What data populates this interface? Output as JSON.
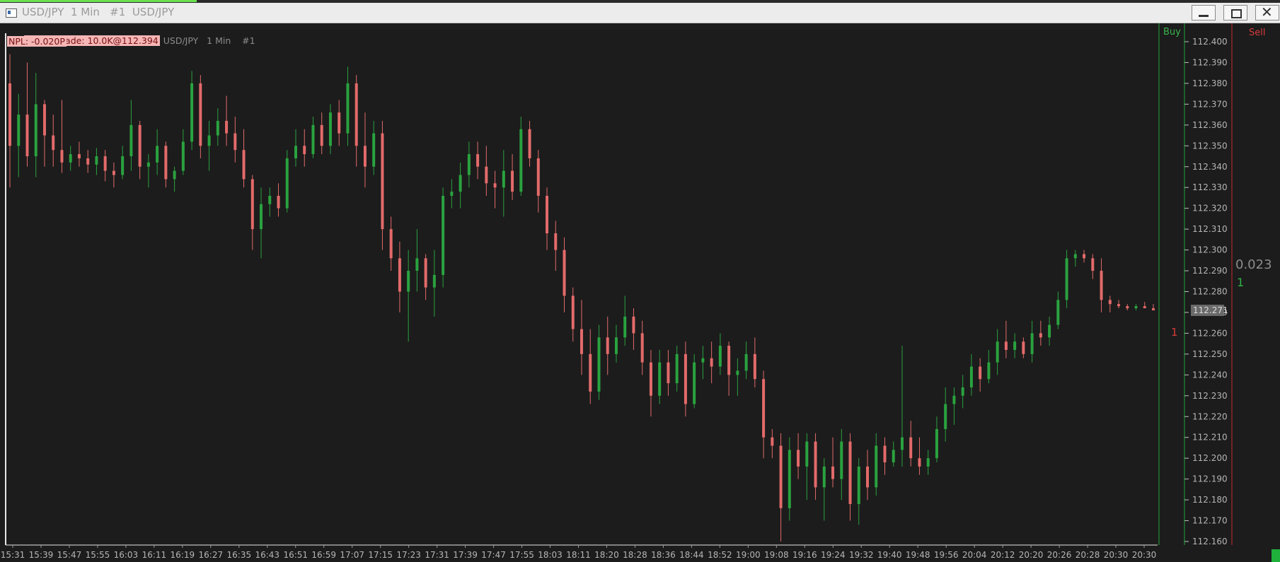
{
  "window": {
    "title": "USD/JPY  1 Min   #1  USD/JPY"
  },
  "chart_header": {
    "sim_tag": "[Sim]   Trade: 10.0K@112.394",
    "caption": "USD/JPY   1 Min    #1",
    "npl": "NPL: -0.020P"
  },
  "order_panel": {
    "buy_label": "Buy",
    "sell_label": "Sell",
    "position_value": "0.023",
    "position_qty": "1",
    "order_qty": "1"
  },
  "colors": {
    "up": "#2aa23f",
    "down": "#e36a6a",
    "buy_line": "#21a33a",
    "sell_line": "#c92a2a",
    "grid_axis": "#d0d0d0",
    "last_price_bg": "#6a6a6a"
  },
  "chart_data": {
    "type": "candlestick",
    "symbol": "USD/JPY",
    "interval": "1 Min",
    "ylim": [
      112.16,
      112.4
    ],
    "y_ticks": [
      "112.160",
      "112.170",
      "112.180",
      "112.190",
      "112.200",
      "112.210",
      "112.220",
      "112.230",
      "112.240",
      "112.250",
      "112.260",
      "112.270",
      "112.280",
      "112.290",
      "112.300",
      "112.310",
      "112.320",
      "112.330",
      "112.340",
      "112.350",
      "112.360",
      "112.370",
      "112.380",
      "112.390",
      "112.400"
    ],
    "x_ticks": [
      "15:31",
      "15:39",
      "15:47",
      "15:55",
      "16:03",
      "16:11",
      "16:19",
      "16:27",
      "16:35",
      "16:43",
      "16:51",
      "16:59",
      "17:07",
      "17:15",
      "17:23",
      "17:31",
      "17:39",
      "17:47",
      "17:55",
      "18:03",
      "18:11",
      "18:20",
      "18:28",
      "18:36",
      "18:44",
      "18:52",
      "19:00",
      "19:08",
      "19:16",
      "19:24",
      "19:32",
      "19:40",
      "19:48",
      "19:56",
      "20:04",
      "20:12",
      "20:20",
      "20:26",
      "20:28",
      "20:30",
      "20:30"
    ],
    "last_price": "112.271",
    "trade_price": 112.394,
    "candles": [
      [
        112.38,
        112.394,
        112.33,
        112.35
      ],
      [
        112.35,
        112.375,
        112.335,
        112.365
      ],
      [
        112.365,
        112.39,
        112.34,
        112.345
      ],
      [
        112.345,
        112.385,
        112.335,
        112.37
      ],
      [
        112.37,
        112.372,
        112.34,
        112.355
      ],
      [
        112.355,
        112.365,
        112.34,
        112.348
      ],
      [
        112.348,
        112.372,
        112.337,
        112.342
      ],
      [
        112.342,
        112.35,
        112.338,
        112.346
      ],
      [
        112.346,
        112.352,
        112.34,
        112.344
      ],
      [
        112.344,
        112.348,
        112.337,
        112.341
      ],
      [
        112.341,
        112.349,
        112.336,
        112.345
      ],
      [
        112.345,
        112.348,
        112.333,
        112.338
      ],
      [
        112.338,
        112.342,
        112.33,
        112.336
      ],
      [
        112.336,
        112.35,
        112.334,
        112.345
      ],
      [
        112.345,
        112.372,
        112.338,
        112.36
      ],
      [
        112.36,
        112.362,
        112.334,
        112.34
      ],
      [
        112.34,
        112.346,
        112.33,
        112.342
      ],
      [
        112.342,
        112.358,
        112.336,
        112.35
      ],
      [
        112.35,
        112.352,
        112.33,
        112.334
      ],
      [
        112.334,
        112.34,
        112.328,
        112.338
      ],
      [
        112.338,
        112.358,
        112.336,
        112.352
      ],
      [
        112.352,
        112.386,
        112.348,
        112.38
      ],
      [
        112.38,
        112.384,
        112.344,
        112.35
      ],
      [
        112.35,
        112.362,
        112.338,
        112.355
      ],
      [
        112.355,
        112.368,
        112.35,
        112.362
      ],
      [
        112.362,
        112.374,
        112.35,
        112.356
      ],
      [
        112.356,
        112.364,
        112.342,
        112.348
      ],
      [
        112.348,
        112.358,
        112.33,
        112.334
      ],
      [
        112.334,
        112.336,
        112.3,
        112.31
      ],
      [
        112.31,
        112.33,
        112.296,
        112.322
      ],
      [
        112.322,
        112.33,
        112.316,
        112.326
      ],
      [
        112.326,
        112.332,
        112.316,
        112.32
      ],
      [
        112.32,
        112.348,
        112.318,
        112.344
      ],
      [
        112.344,
        112.358,
        112.34,
        112.35
      ],
      [
        112.35,
        112.358,
        112.34,
        112.346
      ],
      [
        112.346,
        112.364,
        112.344,
        112.36
      ],
      [
        112.36,
        112.366,
        112.346,
        112.35
      ],
      [
        112.35,
        112.37,
        112.346,
        112.366
      ],
      [
        112.366,
        112.372,
        112.35,
        112.356
      ],
      [
        112.356,
        112.388,
        112.35,
        112.38
      ],
      [
        112.38,
        112.384,
        112.34,
        112.35
      ],
      [
        112.35,
        112.366,
        112.33,
        112.34
      ],
      [
        112.34,
        112.362,
        112.336,
        112.356
      ],
      [
        112.356,
        112.362,
        112.3,
        112.31
      ],
      [
        112.31,
        112.316,
        112.29,
        112.296
      ],
      [
        112.296,
        112.304,
        112.27,
        112.28
      ],
      [
        112.28,
        112.3,
        112.256,
        112.29
      ],
      [
        112.29,
        112.31,
        112.28,
        112.296
      ],
      [
        112.296,
        112.298,
        112.276,
        112.282
      ],
      [
        112.282,
        112.3,
        112.268,
        112.288
      ],
      [
        112.288,
        112.33,
        112.282,
        112.326
      ],
      [
        112.326,
        112.334,
        112.32,
        112.328
      ],
      [
        112.328,
        112.342,
        112.32,
        112.336
      ],
      [
        112.336,
        112.352,
        112.33,
        112.346
      ],
      [
        112.346,
        112.352,
        112.334,
        112.34
      ],
      [
        112.34,
        112.35,
        112.326,
        112.332
      ],
      [
        112.332,
        112.338,
        112.32,
        112.33
      ],
      [
        112.33,
        112.348,
        112.316,
        112.338
      ],
      [
        112.338,
        112.346,
        112.324,
        112.328
      ],
      [
        112.328,
        112.364,
        112.326,
        112.358
      ],
      [
        112.358,
        112.362,
        112.34,
        112.344
      ],
      [
        112.344,
        112.348,
        112.318,
        112.326
      ],
      [
        112.326,
        112.33,
        112.3,
        112.308
      ],
      [
        112.308,
        112.314,
        112.29,
        112.3
      ],
      [
        112.3,
        112.306,
        112.27,
        112.278
      ],
      [
        112.278,
        112.282,
        112.256,
        112.262
      ],
      [
        112.262,
        112.276,
        112.24,
        112.25
      ],
      [
        112.25,
        112.262,
        112.226,
        112.232
      ],
      [
        112.232,
        112.264,
        112.228,
        112.258
      ],
      [
        112.258,
        112.268,
        112.24,
        112.25
      ],
      [
        112.25,
        112.264,
        112.246,
        112.258
      ],
      [
        112.258,
        112.278,
        112.254,
        112.268
      ],
      [
        112.268,
        112.272,
        112.252,
        112.26
      ],
      [
        112.26,
        112.266,
        112.24,
        112.246
      ],
      [
        112.246,
        112.252,
        112.22,
        112.23
      ],
      [
        112.23,
        112.252,
        112.226,
        112.246
      ],
      [
        112.246,
        112.252,
        112.23,
        112.236
      ],
      [
        112.236,
        112.254,
        112.232,
        112.25
      ],
      [
        112.25,
        112.256,
        112.22,
        112.226
      ],
      [
        112.226,
        112.25,
        112.224,
        112.246
      ],
      [
        112.246,
        112.254,
        112.238,
        112.248
      ],
      [
        112.248,
        112.256,
        112.236,
        112.244
      ],
      [
        112.244,
        112.26,
        112.24,
        112.254
      ],
      [
        112.254,
        112.256,
        112.23,
        112.24
      ],
      [
        112.24,
        112.248,
        112.23,
        112.242
      ],
      [
        112.242,
        112.256,
        112.238,
        112.25
      ],
      [
        112.25,
        112.258,
        112.234,
        112.238
      ],
      [
        112.238,
        112.242,
        112.2,
        112.21
      ],
      [
        112.21,
        112.214,
        112.2,
        112.206
      ],
      [
        112.206,
        112.212,
        112.16,
        112.176
      ],
      [
        112.176,
        112.21,
        112.17,
        112.204
      ],
      [
        112.204,
        112.212,
        112.19,
        112.196
      ],
      [
        112.196,
        112.212,
        112.18,
        112.208
      ],
      [
        112.208,
        112.212,
        112.18,
        112.186
      ],
      [
        112.186,
        112.2,
        112.17,
        112.196
      ],
      [
        112.196,
        112.21,
        112.186,
        112.19
      ],
      [
        112.19,
        112.214,
        112.18,
        112.208
      ],
      [
        112.208,
        112.212,
        112.17,
        112.178
      ],
      [
        112.178,
        112.2,
        112.168,
        112.196
      ],
      [
        112.196,
        112.204,
        112.18,
        112.186
      ],
      [
        112.186,
        112.212,
        112.182,
        112.206
      ],
      [
        112.206,
        112.21,
        112.192,
        112.198
      ],
      [
        112.198,
        112.208,
        112.196,
        112.204
      ],
      [
        112.204,
        112.254,
        112.196,
        112.21
      ],
      [
        112.21,
        112.218,
        112.196,
        112.2
      ],
      [
        112.2,
        112.21,
        112.192,
        112.196
      ],
      [
        112.196,
        112.204,
        112.192,
        112.2
      ],
      [
        112.2,
        112.22,
        112.198,
        112.214
      ],
      [
        112.214,
        112.234,
        112.208,
        112.226
      ],
      [
        112.226,
        112.234,
        112.216,
        112.23
      ],
      [
        112.23,
        112.24,
        112.224,
        112.234
      ],
      [
        112.234,
        112.25,
        112.23,
        112.244
      ],
      [
        112.244,
        112.248,
        112.232,
        112.238
      ],
      [
        112.238,
        112.252,
        112.236,
        112.246
      ],
      [
        112.246,
        112.262,
        112.24,
        112.256
      ],
      [
        112.256,
        112.266,
        112.248,
        112.252
      ],
      [
        112.252,
        112.26,
        112.248,
        112.256
      ],
      [
        112.256,
        112.258,
        112.248,
        112.25
      ],
      [
        112.25,
        112.266,
        112.246,
        112.26
      ],
      [
        112.26,
        112.266,
        112.254,
        112.258
      ],
      [
        112.258,
        112.268,
        112.254,
        112.264
      ],
      [
        112.264,
        112.28,
        112.262,
        112.276
      ],
      [
        112.276,
        112.3,
        112.272,
        112.296
      ],
      [
        112.296,
        112.3,
        112.292,
        112.298
      ],
      [
        112.298,
        112.3,
        112.294,
        112.296
      ],
      [
        112.296,
        112.298,
        112.286,
        112.29
      ],
      [
        112.29,
        112.296,
        112.27,
        112.276
      ],
      [
        112.276,
        112.278,
        112.27,
        112.274
      ],
      [
        112.274,
        112.276,
        112.272,
        112.273
      ],
      [
        112.273,
        112.274,
        112.271,
        112.272
      ],
      [
        112.272,
        112.274,
        112.271,
        112.273
      ],
      [
        112.273,
        112.275,
        112.272,
        112.272
      ],
      [
        112.272,
        112.274,
        112.271,
        112.271
      ]
    ]
  }
}
